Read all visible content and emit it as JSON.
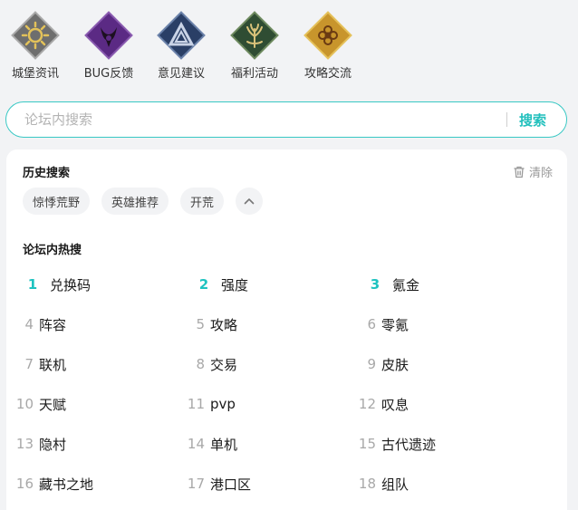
{
  "categories": [
    {
      "label": "城堡资讯",
      "icon": "sun-icon",
      "color": "#7a7a7a",
      "accent": "#e3c25a"
    },
    {
      "label": "BUG反馈",
      "icon": "demon-icon",
      "color": "#5b2a84",
      "accent": "#1c1020"
    },
    {
      "label": "意见建议",
      "icon": "triangle-icon",
      "color": "#2a3f66",
      "accent": "#c9d3e6"
    },
    {
      "label": "福利活动",
      "icon": "tree-icon",
      "color": "#2f4d33",
      "accent": "#d9c27a"
    },
    {
      "label": "攻略交流",
      "icon": "ornament-icon",
      "color": "#c8952c",
      "accent": "#6a3a12"
    }
  ],
  "search": {
    "placeholder": "论坛内搜索",
    "button_label": "搜索"
  },
  "history": {
    "title": "历史搜索",
    "clear_label": "清除",
    "chips": [
      "惊悸荒野",
      "英雄推荐",
      "开荒"
    ]
  },
  "hot": {
    "title": "论坛内热搜",
    "items": [
      {
        "rank": "1",
        "keyword": "兑换码"
      },
      {
        "rank": "2",
        "keyword": "强度"
      },
      {
        "rank": "3",
        "keyword": "氪金"
      },
      {
        "rank": "4",
        "keyword": "阵容"
      },
      {
        "rank": "5",
        "keyword": "攻略"
      },
      {
        "rank": "6",
        "keyword": "零氪"
      },
      {
        "rank": "7",
        "keyword": "联机"
      },
      {
        "rank": "8",
        "keyword": "交易"
      },
      {
        "rank": "9",
        "keyword": "皮肤"
      },
      {
        "rank": "10",
        "keyword": "天赋"
      },
      {
        "rank": "11",
        "keyword": "pvp"
      },
      {
        "rank": "12",
        "keyword": "叹息"
      },
      {
        "rank": "13",
        "keyword": "隐村"
      },
      {
        "rank": "14",
        "keyword": "单机"
      },
      {
        "rank": "15",
        "keyword": "古代遗迹"
      },
      {
        "rank": "16",
        "keyword": "藏书之地"
      },
      {
        "rank": "17",
        "keyword": "港口区"
      },
      {
        "rank": "18",
        "keyword": "组队"
      }
    ]
  },
  "colors": {
    "accent": "#1fc3c0",
    "background": "#f2f3f5"
  }
}
